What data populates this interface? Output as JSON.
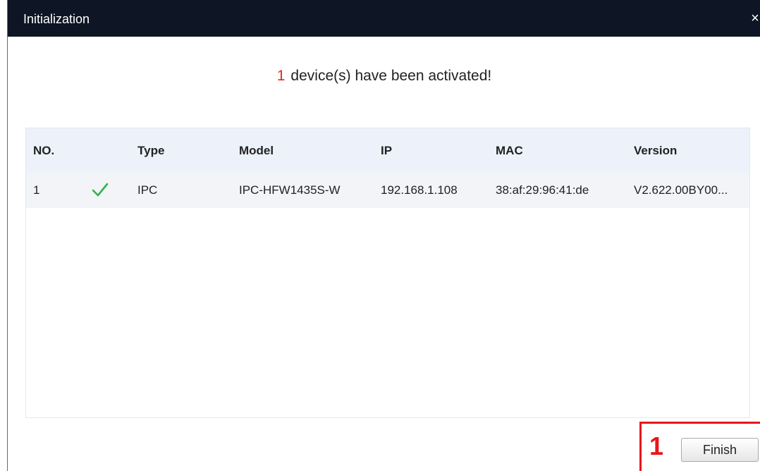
{
  "dialog": {
    "title": "Initialization",
    "close_glyph": "×"
  },
  "message": {
    "count": "1",
    "text": "device(s) have been activated!",
    "count_color": "#e8241e"
  },
  "table": {
    "headers": [
      "NO.",
      "",
      "Type",
      "Model",
      "IP",
      "MAC",
      "Version"
    ],
    "rows": [
      {
        "no": "1",
        "status_icon": "check-icon",
        "type": "IPC",
        "model": "IPC-HFW1435S-W",
        "ip": "192.168.1.108",
        "mac": "38:af:29:96:41:de",
        "version": "V2.622.00BY00..."
      }
    ]
  },
  "footer": {
    "step_number": "1",
    "finish_label": "Finish",
    "highlight_color": "#e8161b"
  },
  "colors": {
    "titlebar": "#0e1524",
    "header_bg": "#edf2fa",
    "check": "#2fb44a"
  }
}
